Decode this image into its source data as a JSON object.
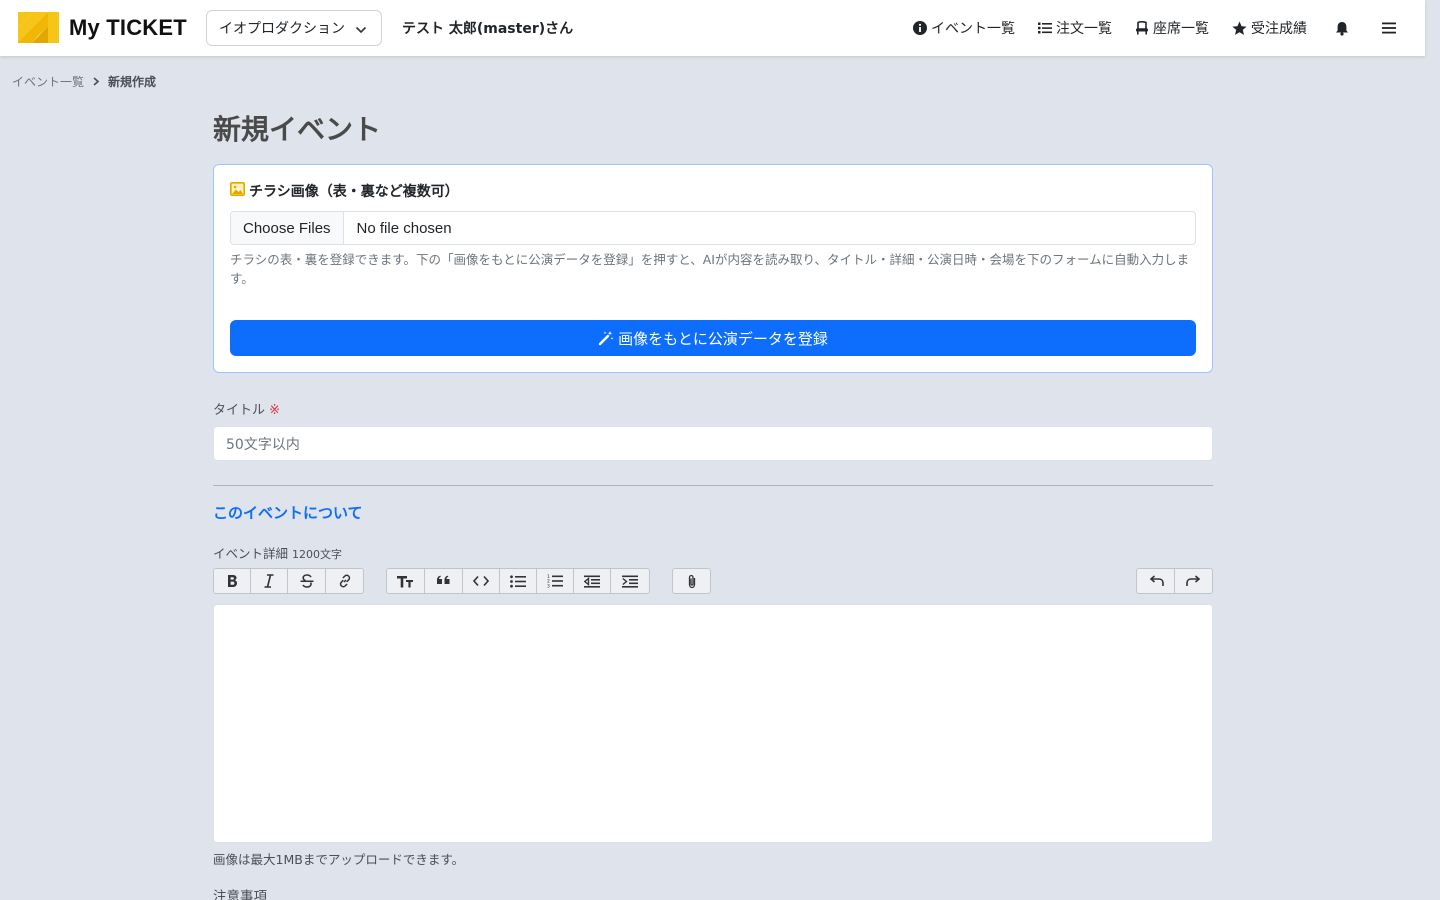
{
  "header": {
    "brand": "My TICKET",
    "org_select": "イオプロダクション",
    "user_name": "テスト 太郎(master)さん",
    "nav": {
      "events": "イベント一覧",
      "orders": "注文一覧",
      "seats": "座席一覧",
      "sales": "受注成績"
    }
  },
  "breadcrumb": {
    "parent": "イベント一覧",
    "current": "新規作成"
  },
  "page": {
    "title": "新規イベント"
  },
  "flyer": {
    "title": "チラシ画像（表・裏など複数可）",
    "file_button": "Choose Files",
    "file_status": "No file chosen",
    "help": "チラシの表・裏を登録できます。下の「画像をもとに公演データを登録」を押すと、AIが内容を読み取り、タイトル・詳細・公演日時・会場を下のフォームに自動入力します。",
    "ai_button": "画像をもとに公演データを登録"
  },
  "title_field": {
    "label": "タイトル",
    "required_mark": "※",
    "placeholder": "50文字以内"
  },
  "about": {
    "heading": "このイベントについて",
    "detail_label": "イベント詳細",
    "detail_limit": "1200文字",
    "editor_hint": "画像は最大1MBまでアップロードできます。"
  },
  "notes": {
    "label": "注意事項"
  },
  "colors": {
    "primary": "#0d6efd",
    "background": "#dee3ec",
    "required": "#dc3545",
    "logo_yellow": "#f5c518"
  }
}
